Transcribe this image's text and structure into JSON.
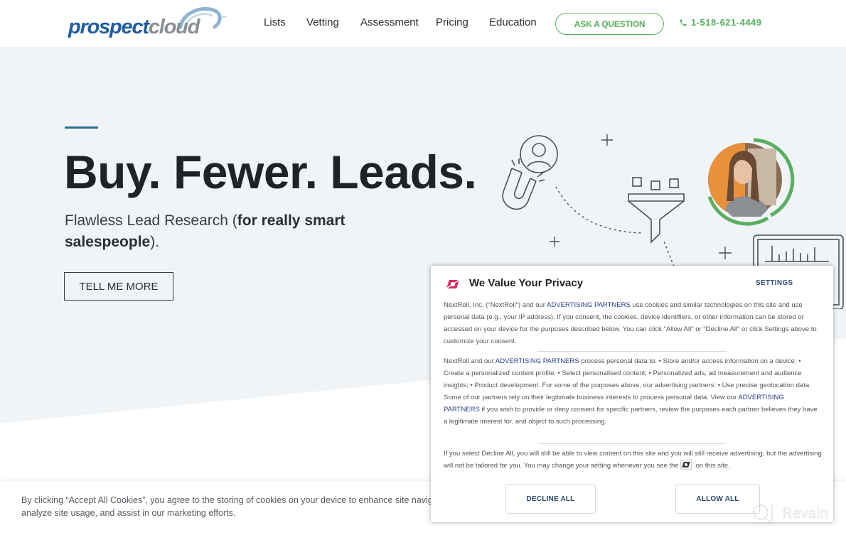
{
  "header": {
    "logo": {
      "primary": "prospect",
      "secondary": "cloud",
      "tm": "™"
    },
    "nav": [
      {
        "label": "Lists"
      },
      {
        "label": "Vetting"
      },
      {
        "label": "Assessment"
      },
      {
        "label": "Pricing"
      },
      {
        "label": "Education"
      }
    ],
    "ask_button": "ASK A QUESTION",
    "phone": {
      "icon": "phone-icon",
      "number": "1-518-621-4449"
    },
    "accent_color": "#5aaf5f"
  },
  "hero": {
    "title": "Buy. Fewer. Leads.",
    "subtitle_light": "Flawless Lead Research (",
    "subtitle_bold": "for really smart salespeople",
    "subtitle_end": ").",
    "cta": "TELL ME MORE"
  },
  "cookie_bar": {
    "line1": "By clicking “Accept All Cookies”, you agree to the storing of cookies on your device to enhance site navigation,",
    "line2": "analyze site usage, and assist in our marketing efforts."
  },
  "privacy_modal": {
    "icon": "nextroll-icon",
    "title": "We Value Your Privacy",
    "settings": "SETTINGS",
    "partners_link": "ADVERTISING PARTNERS",
    "p1_pre": "NextRoll, Inc. (\"NextRoll\") and our ",
    "p1_post": " use cookies and similar technologies on this site and use personal data (e.g., your IP address). If you consent, the cookies, device identifiers, or other information can be stored or accessed on your device for the purposes described below. You can click \"Allow All\" or \"Decline All\" or click Settings above to customize your consent.",
    "p2_pre": "NextRoll and our ",
    "p2_mid": " process personal data to: • Store and/or access information on a device; • Create a personalized content profile; • Select personalised content; • Personalized ads, ad measurement and audience insights; • Product development. For some of the purposes above, our advertising partners: • Use precise geolocation data. Some of our partners rely on their legitimate business interests to process personal data. View our ",
    "p2_post": " if you wish to provide or deny consent for specific partners, review the purposes each partner believes they have a legitimate interest for, and object to such processing.",
    "p3_pre": "If you select Decline All, you will still be able to view content on this site and you will still receive advertising, but the advertising will not be tailored for you. You may change your setting whenever you see the",
    "p3_post": "on this site.",
    "decline": "DECLINE ALL",
    "allow": "ALLOW ALL",
    "brand_color": "#e0245e"
  },
  "watermark": {
    "text": "Revain"
  }
}
